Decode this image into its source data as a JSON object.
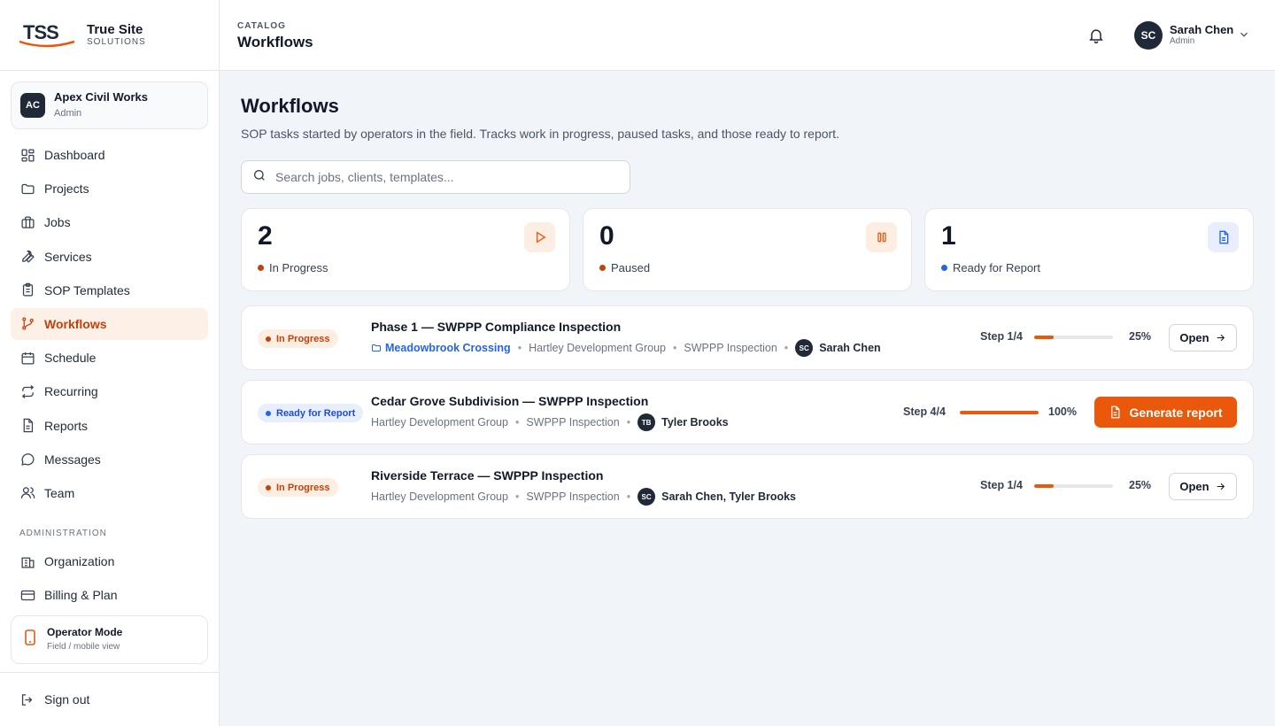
{
  "brand": {
    "logo_text": "TSS",
    "title": "True Site",
    "subtitle": "SOLUTIONS"
  },
  "org": {
    "initials": "AC",
    "name": "Apex Civil Works",
    "role": "Admin"
  },
  "nav": [
    {
      "label": "Dashboard",
      "icon": "dashboard-icon"
    },
    {
      "label": "Projects",
      "icon": "folder-icon"
    },
    {
      "label": "Jobs",
      "icon": "briefcase-icon"
    },
    {
      "label": "Services",
      "icon": "wrench-icon"
    },
    {
      "label": "SOP Templates",
      "icon": "clipboard-icon"
    },
    {
      "label": "Workflows",
      "icon": "workflow-icon",
      "active": true
    },
    {
      "label": "Schedule",
      "icon": "calendar-icon"
    },
    {
      "label": "Recurring",
      "icon": "repeat-icon"
    },
    {
      "label": "Reports",
      "icon": "file-icon"
    },
    {
      "label": "Messages",
      "icon": "chat-icon"
    },
    {
      "label": "Team",
      "icon": "users-icon"
    }
  ],
  "admin_section": {
    "label": "ADMINISTRATION",
    "items": [
      {
        "label": "Organization",
        "icon": "building-icon"
      },
      {
        "label": "Billing & Plan",
        "icon": "credit-card-icon"
      }
    ]
  },
  "operator_mode": {
    "title": "Operator Mode",
    "subtitle": "Field / mobile view"
  },
  "sign_out": "Sign out",
  "topbar": {
    "breadcrumb": "CATALOG",
    "title": "Workflows",
    "user": {
      "initials": "SC",
      "name": "Sarah Chen",
      "role": "Admin"
    }
  },
  "page": {
    "title": "Workflows",
    "description": "SOP tasks started by operators in the field. Tracks work in progress, paused tasks, and those ready to report.",
    "search_placeholder": "Search jobs, clients, templates..."
  },
  "stats": [
    {
      "value": "2",
      "label": "In Progress",
      "color": "#c2410c",
      "icon": "play-icon",
      "icon_bg": "#fdeee3"
    },
    {
      "value": "0",
      "label": "Paused",
      "color": "#c2410c",
      "icon": "pause-icon",
      "icon_bg": "#fdeee3"
    },
    {
      "value": "1",
      "label": "Ready for Report",
      "color": "#2563eb",
      "icon": "document-icon",
      "icon_bg": "#e8eefb"
    }
  ],
  "workflows": [
    {
      "status": "In Progress",
      "title": "Phase 1 — SWPPP Compliance Inspection",
      "project": "Meadowbrook Crossing",
      "client": "Hartley Development Group",
      "template": "SWPPP Inspection",
      "assignee_initials": "SC",
      "assignee": "Sarah Chen",
      "step": "Step 1/4",
      "progress": 0.25,
      "percent": "25%",
      "action": "Open"
    },
    {
      "status": "Ready for Report",
      "title": "Cedar Grove Subdivision — SWPPP Inspection",
      "client": "Hartley Development Group",
      "template": "SWPPP Inspection",
      "assignee_initials": "TB",
      "assignee": "Tyler Brooks",
      "step": "Step 4/4",
      "progress": 1.0,
      "percent": "100%",
      "action": "Generate report"
    },
    {
      "status": "In Progress",
      "title": "Riverside Terrace — SWPPP Inspection",
      "client": "Hartley Development Group",
      "template": "SWPPP Inspection",
      "assignee_initials": "SC",
      "assignee": "Sarah Chen, Tyler Brooks",
      "step": "Step 1/4",
      "progress": 0.25,
      "percent": "25%",
      "action": "Open"
    }
  ],
  "colors": {
    "accent": "#ea580c",
    "in_progress_bg": "#fdeee3",
    "ready_bg": "#e8eefb",
    "link": "#2563eb"
  }
}
